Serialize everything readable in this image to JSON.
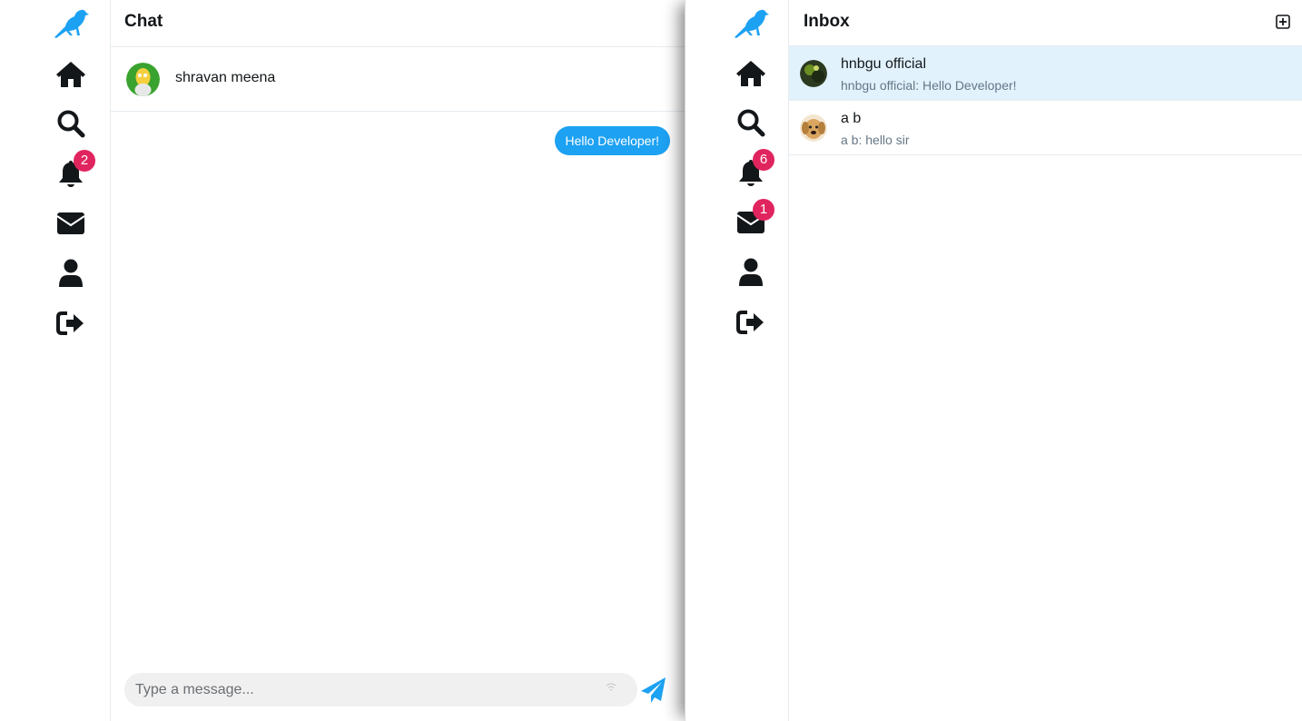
{
  "brand_color": "#1da1f2",
  "badge_color": "#e0245e",
  "left_pane": {
    "nav": [
      {
        "name": "logo",
        "icon": "bird-logo-icon",
        "badge": null
      },
      {
        "name": "home",
        "icon": "home-icon",
        "badge": null
      },
      {
        "name": "search",
        "icon": "search-icon",
        "badge": null
      },
      {
        "name": "notifications",
        "icon": "bell-icon",
        "badge": "2"
      },
      {
        "name": "messages",
        "icon": "envelope-icon",
        "badge": null
      },
      {
        "name": "profile",
        "icon": "user-icon",
        "badge": null
      },
      {
        "name": "logout",
        "icon": "sign-out-icon",
        "badge": null
      }
    ],
    "chat": {
      "title": "Chat",
      "contact_name": "shravan meena",
      "messages": [
        {
          "from": "me",
          "text": "Hello Developer!"
        }
      ],
      "composer_placeholder": "Type a message..."
    }
  },
  "right_pane": {
    "nav": [
      {
        "name": "logo",
        "icon": "bird-logo-icon",
        "badge": null
      },
      {
        "name": "home",
        "icon": "home-icon",
        "badge": null
      },
      {
        "name": "search",
        "icon": "search-icon",
        "badge": null
      },
      {
        "name": "notifications",
        "icon": "bell-icon",
        "badge": "6"
      },
      {
        "name": "messages",
        "icon": "envelope-icon",
        "badge": "1"
      },
      {
        "name": "profile",
        "icon": "user-icon",
        "badge": null
      },
      {
        "name": "logout",
        "icon": "sign-out-icon",
        "badge": null
      }
    ],
    "inbox": {
      "title": "Inbox",
      "conversations": [
        {
          "name": "hnbgu official",
          "preview": "hnbgu official: Hello Developer!",
          "active": true
        },
        {
          "name": "a b",
          "preview": "a b: hello sir",
          "active": false
        }
      ]
    }
  }
}
